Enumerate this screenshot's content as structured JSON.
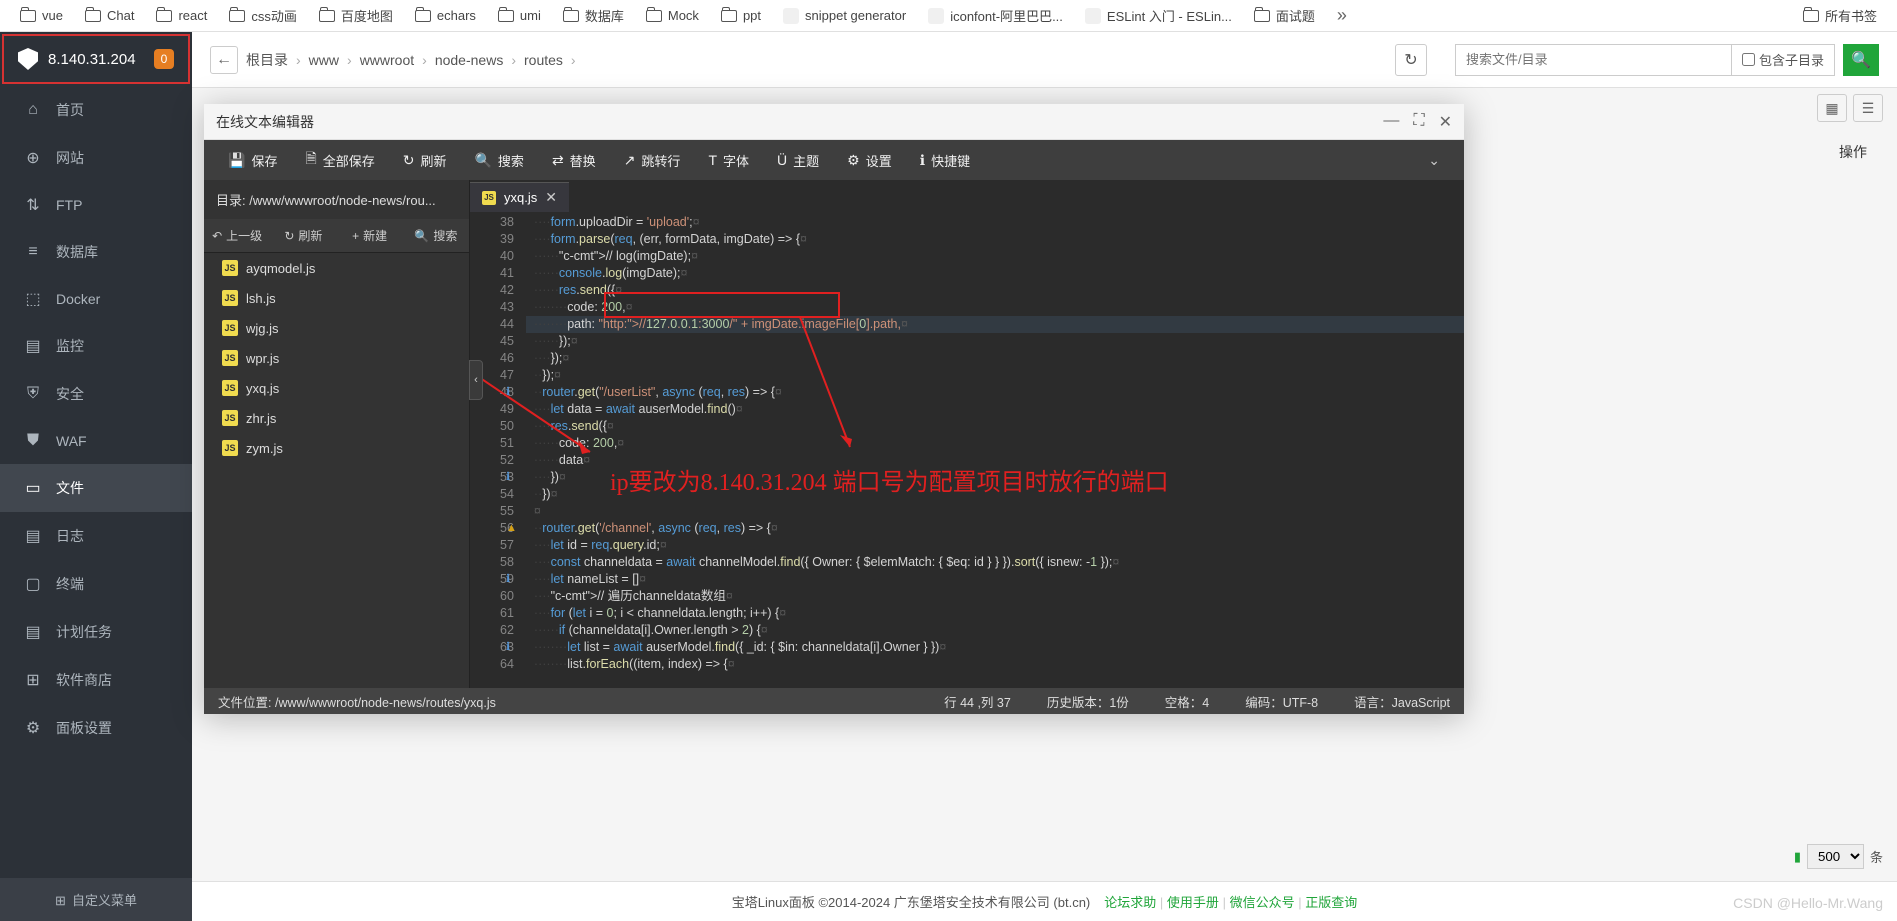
{
  "bookmarks": [
    "vue",
    "Chat",
    "react",
    "css动画",
    "百度地图",
    "echars",
    "umi",
    "数据库",
    "Mock",
    "ppt"
  ],
  "bookmark_extras": [
    {
      "label": "snippet generator",
      "icon": "orange"
    },
    {
      "label": "iconfont-阿里巴巴...",
      "icon": "blue"
    },
    {
      "label": "ESLint 入门 - ESLin...",
      "icon": "purple"
    }
  ],
  "bookmark_tail": "面试题",
  "bookmark_all": "所有书签",
  "sidebar": {
    "ip": "8.140.31.204",
    "badge": "0",
    "items": [
      {
        "icon": "⌂",
        "label": "首页"
      },
      {
        "icon": "⊕",
        "label": "网站"
      },
      {
        "icon": "⇅",
        "label": "FTP"
      },
      {
        "icon": "≡",
        "label": "数据库"
      },
      {
        "icon": "⬚",
        "label": "Docker"
      },
      {
        "icon": "▤",
        "label": "监控"
      },
      {
        "icon": "⛨",
        "label": "安全"
      },
      {
        "icon": "⛊",
        "label": "WAF"
      },
      {
        "icon": "▭",
        "label": "文件",
        "active": true
      },
      {
        "icon": "▤",
        "label": "日志"
      },
      {
        "icon": "▢",
        "label": "终端"
      },
      {
        "icon": "▤",
        "label": "计划任务"
      },
      {
        "icon": "⊞",
        "label": "软件商店"
      },
      {
        "icon": "⚙",
        "label": "面板设置"
      }
    ],
    "footer": "自定义菜单"
  },
  "topbar": {
    "breadcrumb": [
      "根目录",
      "www",
      "wwwroot",
      "node-news",
      "routes"
    ],
    "search_placeholder": "搜索文件/目录",
    "subdir": "包含子目录"
  },
  "action_header": "操作",
  "modal": {
    "title": "在线文本编辑器",
    "toolbar": [
      {
        "icon": "💾",
        "label": "保存"
      },
      {
        "icon": "🗎",
        "label": "全部保存"
      },
      {
        "icon": "↻",
        "label": "刷新"
      },
      {
        "icon": "🔍",
        "label": "搜索"
      },
      {
        "icon": "⇄",
        "label": "替换"
      },
      {
        "icon": "↗",
        "label": "跳转行"
      },
      {
        "icon": "T",
        "label": "字体"
      },
      {
        "icon": "Ü",
        "label": "主题"
      },
      {
        "icon": "⚙",
        "label": "设置"
      },
      {
        "icon": "ℹ",
        "label": "快捷键"
      }
    ],
    "dirlabel": "目录:",
    "dirpath": "/www/wwwroot/node-news/rou...",
    "fp_actions": [
      {
        "icon": "↶",
        "label": "上一级"
      },
      {
        "icon": "↻",
        "label": "刷新"
      },
      {
        "icon": "+",
        "label": "新建"
      },
      {
        "icon": "🔍",
        "label": "搜索"
      }
    ],
    "files": [
      "ayqmodel.js",
      "lsh.js",
      "wjg.js",
      "wpr.js",
      "yxq.js",
      "zhr.js",
      "zym.js"
    ],
    "tab": "yxq.js",
    "annotation": "ip要改为8.140.31.204 端口号为配置项目时放行的端口",
    "code": [
      {
        "n": 38,
        "raw": "    form.uploadDir = 'upload';"
      },
      {
        "n": 39,
        "raw": "    form.parse(req, (err, formData, imgDate) => {"
      },
      {
        "n": 40,
        "raw": "      // log(imgDate);"
      },
      {
        "n": 41,
        "raw": "      console.log(imgDate);"
      },
      {
        "n": 42,
        "raw": "      res.send({"
      },
      {
        "n": 43,
        "raw": "        code: 200,"
      },
      {
        "n": 44,
        "raw": "        path: \"http://127.0.0.1:3000/\" + imgDate.imageFile[0].path,",
        "hl": true
      },
      {
        "n": 45,
        "raw": "      });"
      },
      {
        "n": 46,
        "raw": "    });"
      },
      {
        "n": 47,
        "raw": "  });"
      },
      {
        "n": 48,
        "raw": "  router.get(\"/userList\", async (req, res) => {",
        "info": true
      },
      {
        "n": 49,
        "raw": "    let data = await auserModel.find()"
      },
      {
        "n": 50,
        "raw": "    res.send({"
      },
      {
        "n": 51,
        "raw": "      code: 200,"
      },
      {
        "n": 52,
        "raw": "      data"
      },
      {
        "n": 53,
        "raw": "    })",
        "info": true
      },
      {
        "n": 54,
        "raw": "  })"
      },
      {
        "n": 55,
        "raw": ""
      },
      {
        "n": 56,
        "raw": "  router.get('/channel', async (req, res) => {",
        "warn": true
      },
      {
        "n": 57,
        "raw": "    let id = req.query.id;"
      },
      {
        "n": 58,
        "raw": "    const channeldata = await channelModel.find({ Owner: { $elemMatch: { $eq: id } } }).sort({ isnew: -1 });"
      },
      {
        "n": 59,
        "raw": "    let nameList = []",
        "info": true
      },
      {
        "n": 60,
        "raw": "    // 遍历channeldata数组"
      },
      {
        "n": 61,
        "raw": "    for (let i = 0; i < channeldata.length; i++) {"
      },
      {
        "n": 62,
        "raw": "      if (channeldata[i].Owner.length > 2) {"
      },
      {
        "n": 63,
        "raw": "        let list = await auserModel.find({ _id: { $in: channeldata[i].Owner } })",
        "info": true
      },
      {
        "n": 64,
        "raw": "        list.forEach((item, index) => {"
      }
    ],
    "status": {
      "path_label": "文件位置:",
      "path": "/www/wwwroot/node-news/routes/yxq.js",
      "pos": "行 44 ,列 37",
      "history": "历史版本：1份",
      "indent": "空格：4",
      "encoding": "编码：UTF-8",
      "lang": "语言：JavaScript"
    }
  },
  "page_size": "500",
  "page_unit": "条",
  "footer": {
    "copyright": "宝塔Linux面板 ©2014-2024 广东堡塔安全技术有限公司 (bt.cn)",
    "links": [
      "论坛求助",
      "使用手册",
      "微信公众号",
      "正版查询"
    ]
  },
  "watermark": "CSDN @Hello-Mr.Wang"
}
